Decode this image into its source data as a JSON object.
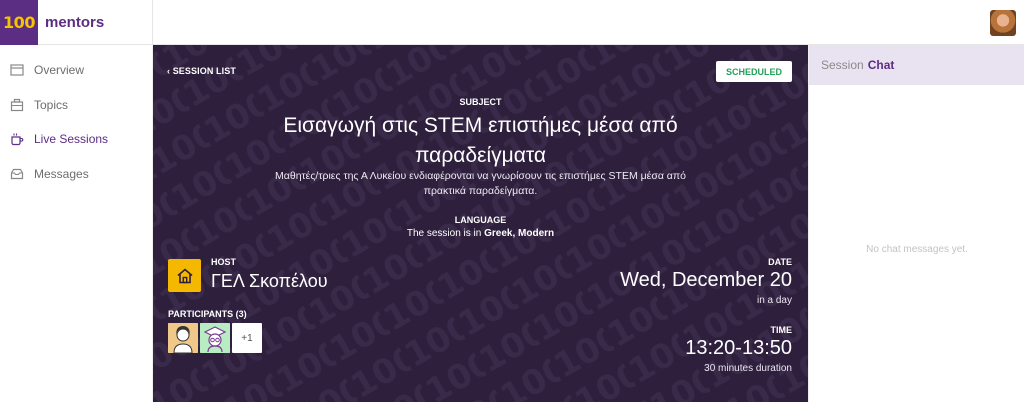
{
  "brand": {
    "logo_mark": "100",
    "name": "mentors",
    "color": "#5b2d83",
    "mark_color": "#f5c400"
  },
  "sidebar": {
    "items": [
      {
        "label": "Overview",
        "icon": "overview-icon",
        "active": false
      },
      {
        "label": "Topics",
        "icon": "topics-icon",
        "active": false
      },
      {
        "label": "Live Sessions",
        "icon": "live-sessions-icon",
        "active": true
      },
      {
        "label": "Messages",
        "icon": "messages-icon",
        "active": false
      }
    ]
  },
  "session": {
    "back_label": "SESSION LIST",
    "status": "SCHEDULED",
    "subject_label": "SUBJECT",
    "subject_title": "Εισαγωγή στις STEM επιστήμες μέσα από παραδείγματα",
    "subject_description": "Μαθητές/τριες της Α Λυκείου ενδιαφέρονται να γνωρίσουν τις επιστήμες STEM μέσα από πρακτικά παραδείγματα.",
    "language_label": "LANGUAGE",
    "language_prefix": "The session is in",
    "language_value": "Greek, Modern",
    "host_label": "HOST",
    "host_name": "ΓΕΛ Σκοπέλου",
    "participants_label": "PARTICIPANTS (3)",
    "participants_more": "+1",
    "date_label": "DATE",
    "date_value": "Wed, December 20",
    "date_relative": "in a day",
    "time_label": "TIME",
    "time_value": "13:20-13:50",
    "time_duration": "30 minutes duration",
    "colors": {
      "panel_bg": "#2e1f3d",
      "status": "#27a05a",
      "host_icon_bg": "#f5b800"
    }
  },
  "chat": {
    "title_prefix": "Session",
    "title_strong": "Chat",
    "empty_text": "No chat messages yet."
  }
}
